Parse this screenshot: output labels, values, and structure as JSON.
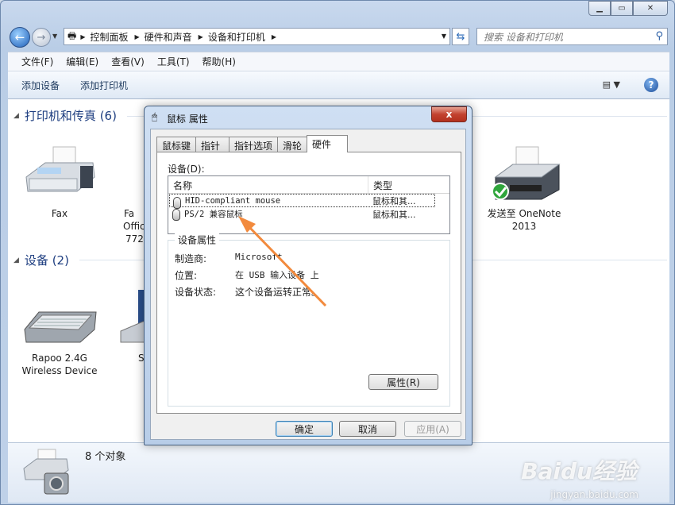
{
  "address": {
    "segments": [
      "控制面板",
      "硬件和声音",
      "设备和打印机"
    ]
  },
  "search": {
    "placeholder": "搜索 设备和打印机"
  },
  "menu": [
    "文件(F)",
    "编辑(E)",
    "查看(V)",
    "工具(T)",
    "帮助(H)"
  ],
  "toolbar": {
    "add_device": "添加设备",
    "add_printer": "添加打印机"
  },
  "groups": {
    "printers": "打印机和传真 (6)",
    "devices": "设备 (2)"
  },
  "printer_items": [
    {
      "label": "Fax"
    },
    {
      "label": "Fa",
      "label2": "Offic",
      "label3": "772("
    },
    {
      "label": "发送至 OneNote",
      "label2": "2013"
    }
  ],
  "device_items": [
    {
      "label": "Rapoo 2.4G",
      "label2": "Wireless Device"
    },
    {
      "label": "S"
    }
  ],
  "details": {
    "count": "8 个对象"
  },
  "dialog": {
    "title": "鼠标 属性",
    "close": "x",
    "tabs": [
      "鼠标键",
      "指针",
      "指针选项",
      "滑轮",
      "硬件"
    ],
    "devices_label": "设备(D):",
    "columns": [
      "名称",
      "类型"
    ],
    "rows": [
      {
        "name": "HID-compliant mouse",
        "type": "鼠标和其..."
      },
      {
        "name": "PS/2 兼容鼠标",
        "type": "鼠标和其..."
      }
    ],
    "properties_title": "设备属性",
    "manufacturer_label": "制造商:",
    "manufacturer_value": "Microsoft",
    "location_label": "位置:",
    "location_value": "在 USB 输入设备 上",
    "status_label": "设备状态:",
    "status_value": "这个设备运转正常。",
    "properties_button": "属性(R)",
    "ok": "确定",
    "cancel": "取消",
    "apply": "应用(A)"
  },
  "watermark": {
    "brand": "Baidu经验",
    "url": "jingyan.baidu.com"
  },
  "colors": {
    "accent": "#1e3e80",
    "arrow": "#f28a3d"
  }
}
